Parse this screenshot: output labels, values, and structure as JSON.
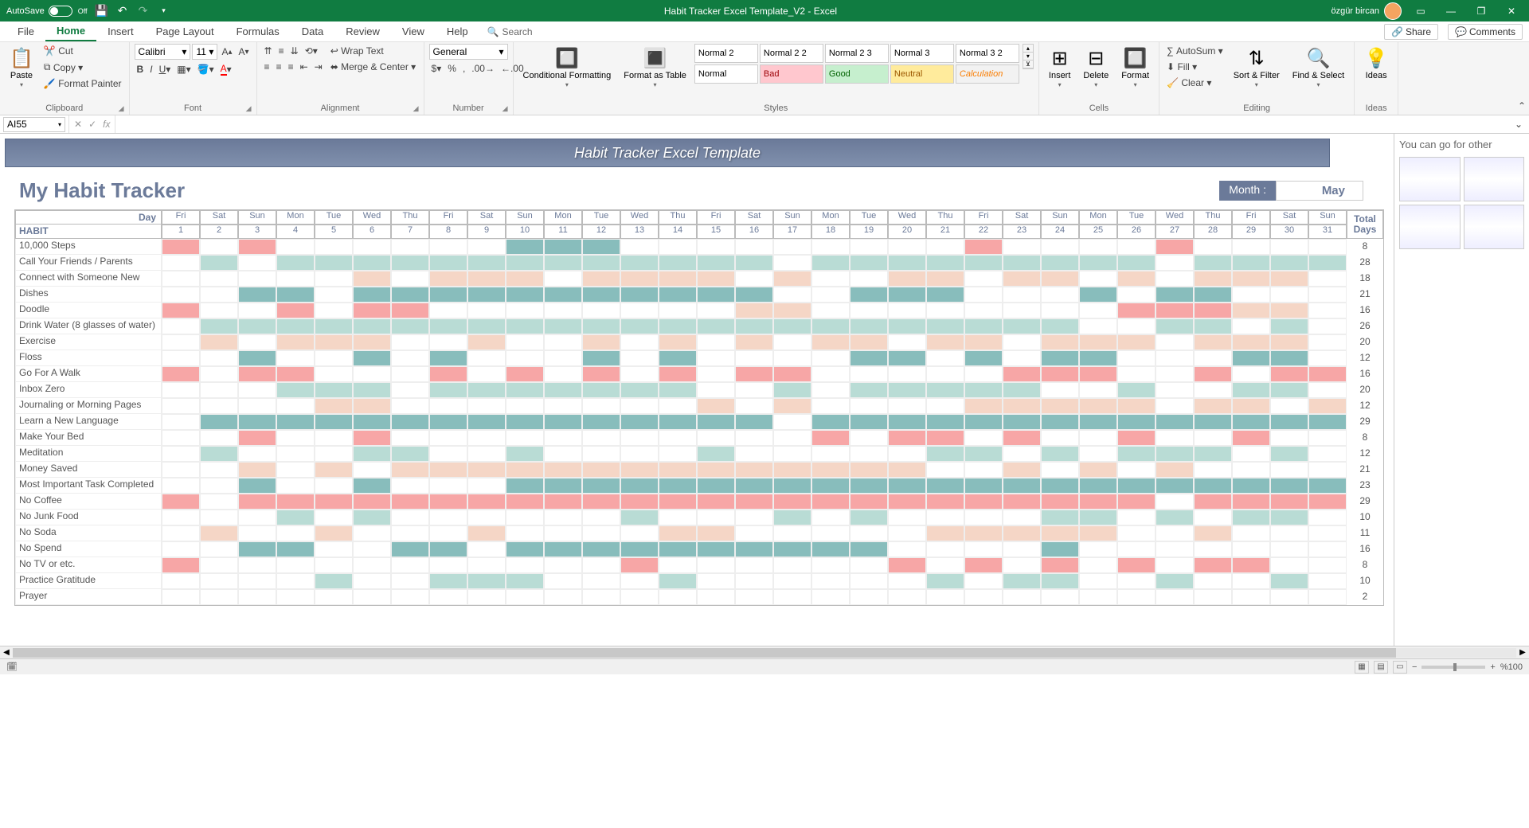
{
  "titlebar": {
    "autosave_label": "AutoSave",
    "autosave_state": "Off",
    "title": "Habit Tracker Excel Template_V2  -  Excel",
    "user": "özgür bircan"
  },
  "tabs": {
    "file": "File",
    "home": "Home",
    "insert": "Insert",
    "pagelayout": "Page Layout",
    "formulas": "Formulas",
    "data": "Data",
    "review": "Review",
    "view": "View",
    "help": "Help",
    "search": "Search",
    "share": "Share",
    "comments": "Comments"
  },
  "ribbon": {
    "clipboard": {
      "paste": "Paste",
      "cut": "Cut",
      "copy": "Copy",
      "fp": "Format Painter",
      "label": "Clipboard"
    },
    "font": {
      "name": "Calibri",
      "size": "11",
      "label": "Font"
    },
    "alignment": {
      "wrap": "Wrap Text",
      "merge": "Merge & Center",
      "label": "Alignment"
    },
    "number": {
      "format": "General",
      "label": "Number"
    },
    "styles": {
      "cf": "Conditional Formatting",
      "fat": "Format as Table",
      "cells": [
        "Normal 2",
        "Normal 2 2",
        "Normal 2 3",
        "Normal 3",
        "Normal 3 2",
        "Normal",
        "Bad",
        "Good",
        "Neutral",
        "Calculation"
      ],
      "label": "Styles"
    },
    "cells2": {
      "insert": "Insert",
      "delete": "Delete",
      "format": "Format",
      "label": "Cells"
    },
    "editing": {
      "autosum": "AutoSum",
      "fill": "Fill",
      "clear": "Clear",
      "sf": "Sort & Filter",
      "fs": "Find & Select",
      "label": "Editing"
    },
    "ideas": {
      "ideas": "Ideas",
      "label": "Ideas"
    }
  },
  "formulabar": {
    "namebox": "AI55"
  },
  "sheet": {
    "banner": "Habit Tracker Excel Template",
    "title": "My Habit Tracker",
    "month_label": "Month :",
    "month_value": "May",
    "day_label": "Day",
    "habit_label": "HABIT",
    "total_days_1": "Total",
    "total_days_2": "Days",
    "weekdays": [
      "Fri",
      "Sat",
      "Sun",
      "Mon",
      "Tue",
      "Wed",
      "Thu",
      "Fri",
      "Sat",
      "Sun",
      "Mon",
      "Tue",
      "Wed",
      "Thu",
      "Fri",
      "Sat",
      "Sun",
      "Mon",
      "Tue",
      "Wed",
      "Thu",
      "Fri",
      "Sat",
      "Sun",
      "Mon",
      "Tue",
      "Wed",
      "Thu",
      "Fri",
      "Sat",
      "Sun"
    ],
    "daynums": [
      "1",
      "2",
      "3",
      "4",
      "5",
      "6",
      "7",
      "8",
      "9",
      "10",
      "11",
      "12",
      "13",
      "14",
      "15",
      "16",
      "17",
      "18",
      "19",
      "20",
      "21",
      "22",
      "23",
      "24",
      "25",
      "26",
      "27",
      "28",
      "29",
      "30",
      "31"
    ],
    "habits": [
      {
        "name": "10,000 Steps",
        "total": "8",
        "cells": [
          "p",
          "",
          "p",
          "",
          "",
          "",
          "",
          "",
          "",
          "t",
          "t",
          "t",
          "",
          "",
          "",
          "",
          "",
          "",
          "",
          "",
          "",
          "p",
          "",
          "",
          "",
          "",
          "p",
          "",
          "",
          "",
          ""
        ]
      },
      {
        "name": "Call Your Friends / Parents",
        "total": "28",
        "cells": [
          "",
          "m",
          "",
          "m",
          "m",
          "m",
          "m",
          "m",
          "m",
          "m",
          "m",
          "m",
          "m",
          "m",
          "m",
          "m",
          "",
          "m",
          "m",
          "m",
          "m",
          "m",
          "m",
          "m",
          "m",
          "m",
          "",
          "m",
          "m",
          "m",
          "m"
        ]
      },
      {
        "name": "Connect with Someone New",
        "total": "18",
        "cells": [
          "",
          "",
          "",
          "",
          "",
          "c",
          "",
          "c",
          "c",
          "c",
          "",
          "c",
          "c",
          "c",
          "c",
          "",
          "c",
          "",
          "",
          "c",
          "c",
          "",
          "c",
          "c",
          "",
          "c",
          "",
          "c",
          "c",
          "c",
          ""
        ]
      },
      {
        "name": "Dishes",
        "total": "21",
        "cells": [
          "",
          "",
          "t",
          "t",
          "",
          "t",
          "t",
          "t",
          "t",
          "t",
          "t",
          "t",
          "t",
          "t",
          "t",
          "t",
          "",
          "",
          "t",
          "t",
          "t",
          "",
          "",
          "",
          "t",
          "",
          "t",
          "t",
          "",
          "",
          ""
        ]
      },
      {
        "name": "Doodle",
        "total": "16",
        "cells": [
          "p",
          "",
          "",
          "p",
          "",
          "p",
          "p",
          "",
          "",
          "",
          "",
          "",
          "",
          "",
          "",
          "c",
          "c",
          "",
          "",
          "",
          "",
          "",
          "",
          "",
          "",
          "p",
          "p",
          "p",
          "c",
          "c",
          ""
        ]
      },
      {
        "name": "Drink Water (8 glasses of water)",
        "total": "26",
        "cells": [
          "",
          "m",
          "m",
          "m",
          "m",
          "m",
          "m",
          "m",
          "m",
          "m",
          "m",
          "m",
          "m",
          "m",
          "m",
          "m",
          "m",
          "m",
          "m",
          "m",
          "m",
          "m",
          "m",
          "m",
          "",
          "",
          "m",
          "m",
          "",
          "m",
          ""
        ]
      },
      {
        "name": "Exercise",
        "total": "20",
        "cells": [
          "",
          "c",
          "",
          "c",
          "c",
          "c",
          "",
          "",
          "c",
          "",
          "",
          "c",
          "",
          "c",
          "",
          "c",
          "",
          "c",
          "c",
          "",
          "c",
          "c",
          "",
          "c",
          "c",
          "c",
          "",
          "c",
          "c",
          "c",
          ""
        ]
      },
      {
        "name": "Floss",
        "total": "12",
        "cells": [
          "",
          "",
          "t",
          "",
          "",
          "t",
          "",
          "t",
          "",
          "",
          "",
          "t",
          "",
          "t",
          "",
          "",
          "",
          "",
          "t",
          "t",
          "",
          "t",
          "",
          "t",
          "t",
          "",
          "",
          "",
          "t",
          "t",
          ""
        ]
      },
      {
        "name": "Go For A Walk",
        "total": "16",
        "cells": [
          "p",
          "",
          "p",
          "p",
          "",
          "",
          "",
          "p",
          "",
          "p",
          "",
          "p",
          "",
          "p",
          "",
          "p",
          "p",
          "",
          "",
          "",
          "",
          "",
          "p",
          "p",
          "p",
          "",
          "",
          "p",
          "",
          "p",
          "p"
        ]
      },
      {
        "name": "Inbox Zero",
        "total": "20",
        "cells": [
          "",
          "",
          "",
          "m",
          "m",
          "m",
          "",
          "m",
          "m",
          "m",
          "m",
          "m",
          "m",
          "m",
          "",
          "",
          "m",
          "",
          "m",
          "m",
          "m",
          "m",
          "m",
          "",
          "",
          "m",
          "",
          "",
          "m",
          "m",
          ""
        ]
      },
      {
        "name": "Journaling or Morning Pages",
        "total": "12",
        "cells": [
          "",
          "",
          "",
          "",
          "c",
          "c",
          "",
          "",
          "",
          "",
          "",
          "",
          "",
          "",
          "c",
          "",
          "c",
          "",
          "",
          "",
          "",
          "c",
          "c",
          "c",
          "c",
          "c",
          "",
          "c",
          "c",
          "",
          "c"
        ]
      },
      {
        "name": "Learn a New Language",
        "total": "29",
        "cells": [
          "",
          "t",
          "t",
          "t",
          "t",
          "t",
          "t",
          "t",
          "t",
          "t",
          "t",
          "t",
          "t",
          "t",
          "t",
          "t",
          "",
          "t",
          "t",
          "t",
          "t",
          "t",
          "t",
          "t",
          "t",
          "t",
          "t",
          "t",
          "t",
          "t",
          "t"
        ]
      },
      {
        "name": "Make Your Bed",
        "total": "8",
        "cells": [
          "",
          "",
          "p",
          "",
          "",
          "p",
          "",
          "",
          "",
          "",
          "",
          "",
          "",
          "",
          "",
          "",
          "",
          "p",
          "",
          "p",
          "p",
          "",
          "p",
          "",
          "",
          "p",
          "",
          "",
          "p",
          "",
          ""
        ]
      },
      {
        "name": "Meditation",
        "total": "12",
        "cells": [
          "",
          "m",
          "",
          "",
          "",
          "m",
          "m",
          "",
          "",
          "m",
          "",
          "",
          "",
          "",
          "m",
          "",
          "",
          "",
          "",
          "",
          "m",
          "m",
          "",
          "m",
          "",
          "m",
          "m",
          "m",
          "",
          "m",
          ""
        ]
      },
      {
        "name": "Money Saved",
        "total": "21",
        "cells": [
          "",
          "",
          "c",
          "",
          "c",
          "",
          "c",
          "c",
          "c",
          "c",
          "c",
          "c",
          "c",
          "c",
          "c",
          "c",
          "c",
          "c",
          "c",
          "c",
          "",
          "",
          "c",
          "",
          "c",
          "",
          "c",
          "",
          "",
          "",
          ""
        ]
      },
      {
        "name": "Most Important Task Completed",
        "total": "23",
        "cells": [
          "",
          "",
          "t",
          "",
          "",
          "t",
          "",
          "",
          "",
          "t",
          "t",
          "t",
          "t",
          "t",
          "t",
          "t",
          "t",
          "t",
          "t",
          "t",
          "t",
          "t",
          "t",
          "t",
          "t",
          "t",
          "t",
          "t",
          "t",
          "t",
          "t"
        ]
      },
      {
        "name": "No Coffee",
        "total": "29",
        "cells": [
          "p",
          "",
          "p",
          "p",
          "p",
          "p",
          "p",
          "p",
          "p",
          "p",
          "p",
          "p",
          "p",
          "p",
          "p",
          "p",
          "p",
          "p",
          "p",
          "p",
          "p",
          "p",
          "p",
          "p",
          "p",
          "p",
          "",
          "p",
          "p",
          "p",
          "p"
        ]
      },
      {
        "name": "No Junk Food",
        "total": "10",
        "cells": [
          "",
          "",
          "",
          "m",
          "",
          "m",
          "",
          "",
          "",
          "",
          "",
          "",
          "m",
          "",
          "",
          "",
          "m",
          "",
          "m",
          "",
          "",
          "",
          "",
          "m",
          "m",
          "",
          "m",
          "",
          "m",
          "m",
          ""
        ]
      },
      {
        "name": "No Soda",
        "total": "11",
        "cells": [
          "",
          "c",
          "",
          "",
          "c",
          "",
          "",
          "",
          "c",
          "",
          "",
          "",
          "",
          "c",
          "c",
          "",
          "",
          "",
          "",
          "",
          "c",
          "c",
          "c",
          "c",
          "c",
          "",
          "",
          "c",
          "",
          "",
          ""
        ]
      },
      {
        "name": "No Spend",
        "total": "16",
        "cells": [
          "",
          "",
          "t",
          "t",
          "",
          "",
          "t",
          "t",
          "",
          "t",
          "t",
          "t",
          "t",
          "t",
          "t",
          "t",
          "t",
          "t",
          "t",
          "",
          "",
          "",
          "",
          "t",
          "",
          "",
          "",
          "",
          "",
          "",
          ""
        ]
      },
      {
        "name": "No TV or etc.",
        "total": "8",
        "cells": [
          "p",
          "",
          "",
          "",
          "",
          "",
          "",
          "",
          "",
          "",
          "",
          "",
          "p",
          "",
          "",
          "",
          "",
          "",
          "",
          "p",
          "",
          "p",
          "",
          "p",
          "",
          "p",
          "",
          "p",
          "p",
          "",
          ""
        ]
      },
      {
        "name": "Practice Gratitude",
        "total": "10",
        "cells": [
          "",
          "",
          "",
          "",
          "m",
          "",
          "",
          "m",
          "m",
          "m",
          "",
          "",
          "",
          "m",
          "",
          "",
          "",
          "",
          "",
          "",
          "m",
          "",
          "m",
          "m",
          "",
          "",
          "m",
          "",
          "",
          "m",
          ""
        ]
      },
      {
        "name": "Prayer",
        "total": "2",
        "cells": [
          "",
          "",
          "",
          "",
          "",
          "",
          "",
          "",
          "",
          "",
          "",
          "",
          "",
          "",
          "",
          "",
          "",
          "",
          "",
          "",
          "",
          "",
          "",
          "",
          "",
          "",
          "",
          "",
          "",
          "",
          ""
        ]
      }
    ]
  },
  "rightpanel": {
    "title": "You can go for other"
  },
  "status": {
    "zoom": "%100"
  }
}
